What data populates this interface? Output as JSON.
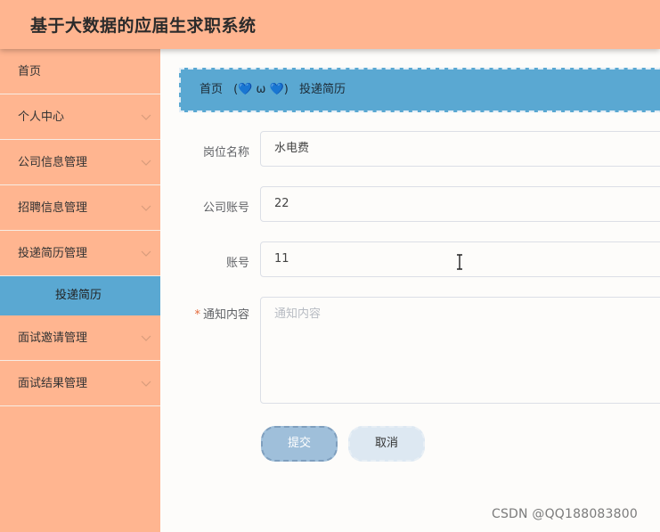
{
  "app": {
    "title": "基于大数据的应届生求职系统"
  },
  "sidebar": {
    "items": [
      {
        "label": "首页"
      },
      {
        "label": "个人中心"
      },
      {
        "label": "公司信息管理"
      },
      {
        "label": "招聘信息管理"
      },
      {
        "label": "投递简历管理"
      },
      {
        "label": "面试邀请管理"
      },
      {
        "label": "面试结果管理"
      }
    ],
    "active_subitem": "投递简历"
  },
  "breadcrumb": {
    "home": "首页",
    "separator": "(💙 ω 💙)",
    "current": "投递简历"
  },
  "form": {
    "fields": [
      {
        "label": "岗位名称",
        "value": "水电费",
        "required": false
      },
      {
        "label": "公司账号",
        "value": "22",
        "required": false
      },
      {
        "label": "账号",
        "value": "11",
        "required": false
      },
      {
        "label": "通知内容",
        "value": "",
        "placeholder": "通知内容",
        "required": true,
        "required_mark": "*"
      }
    ],
    "submit_label": "提交",
    "cancel_label": "取消"
  },
  "watermark": "CSDN @QQ188083800",
  "colors": {
    "header": "#ffb590",
    "accent": "#5aa8d2",
    "submit": "#9fbfda",
    "cancel": "#dde8f2"
  }
}
